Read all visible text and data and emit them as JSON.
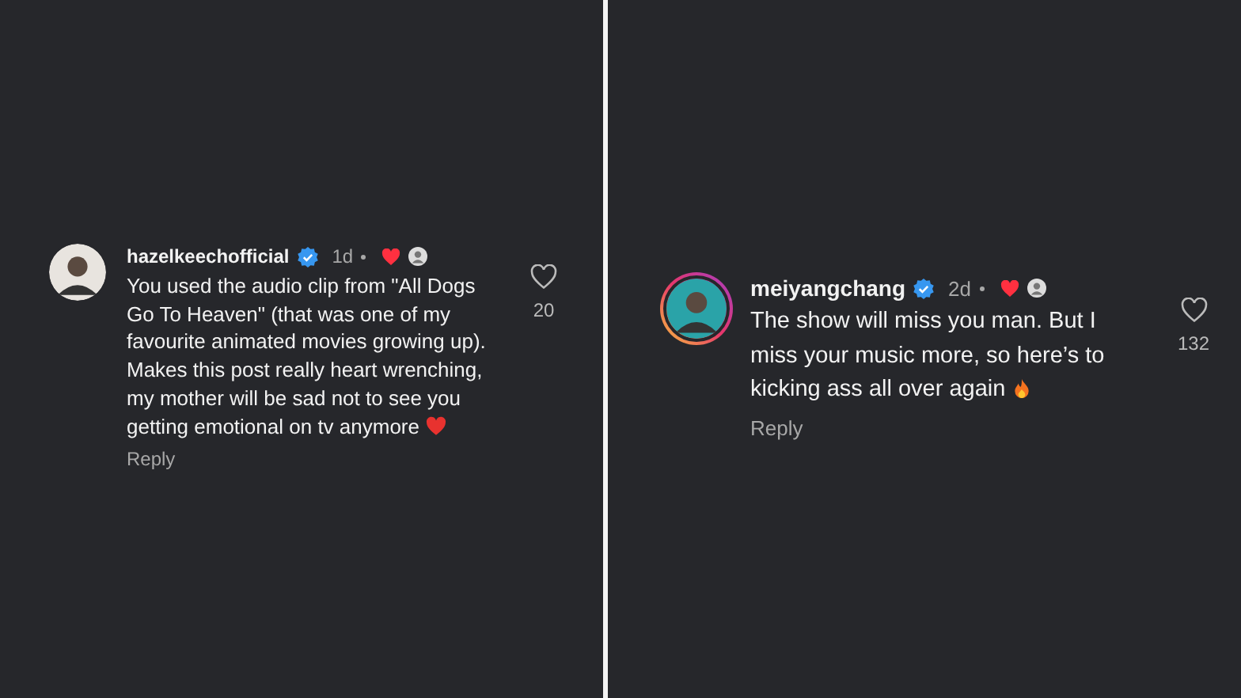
{
  "comments": [
    {
      "username": "hazelkeechofficial",
      "verified": true,
      "story_ring": false,
      "time": "1d",
      "liked_by_author": true,
      "text": "You used the audio clip from \"All Dogs Go To Heaven\" (that was one of my favourite animated movies growing up). Makes this post really heart wrenching, my mother will be sad not to see you getting emotional on tv anymore",
      "end_emoji": {
        "kind": "heart"
      },
      "likes": "20",
      "reply": "Reply"
    },
    {
      "username": "meiyangchang",
      "verified": true,
      "story_ring": true,
      "time": "2d",
      "liked_by_author": true,
      "text": "The show will miss you man. But I miss your music more, so here’s to kicking ass all over again",
      "end_emoji": {
        "kind": "fire"
      },
      "likes": "132",
      "reply": "Reply"
    }
  ]
}
